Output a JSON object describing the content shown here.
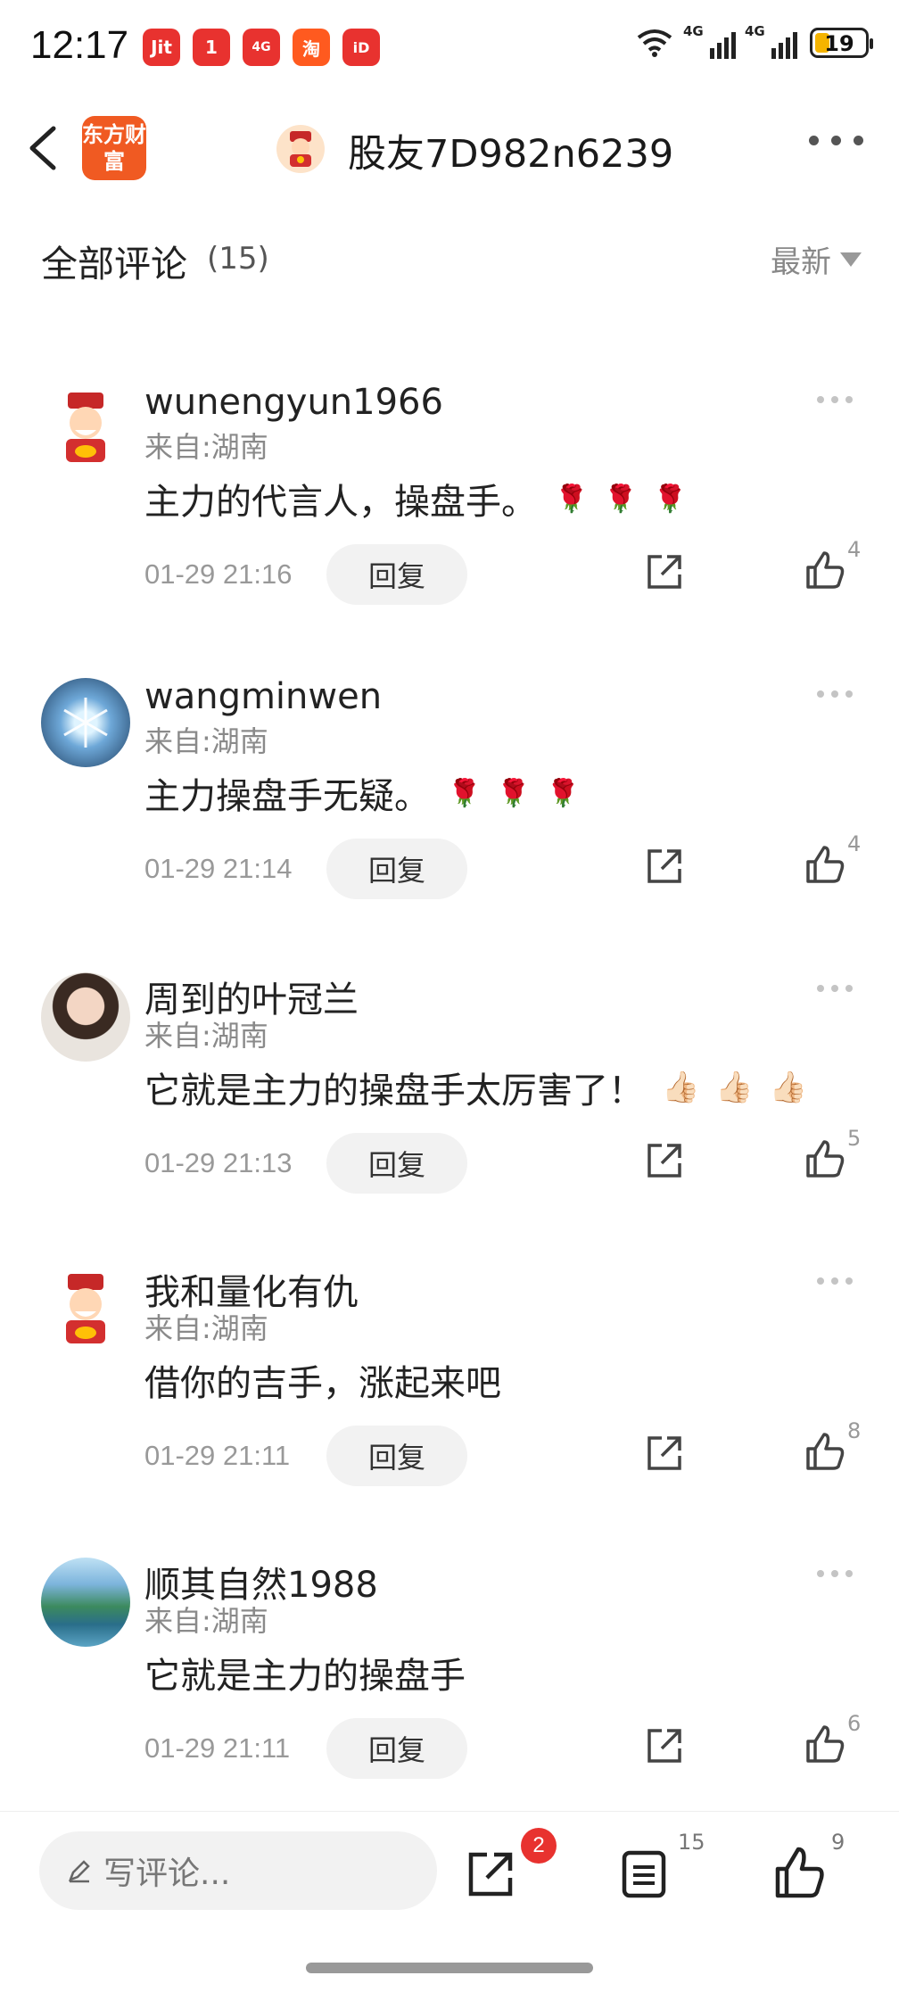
{
  "status_bar": {
    "time": "12:17",
    "app_icons": [
      "Jit",
      "1",
      "4G",
      "淘",
      "iD"
    ],
    "network_1": "4G",
    "network_2": "4G",
    "battery": "19"
  },
  "header": {
    "brand_logo": "东方财富",
    "title": "股友7D982n6239"
  },
  "section": {
    "title": "全部评论",
    "count": "(15)",
    "sort_label": "最新"
  },
  "comments": [
    {
      "username": "wunengyun1966",
      "location": "来自:湖南",
      "text": "主力的代言人，操盘手。",
      "emoji": "rose",
      "time": "01-29 21:16",
      "reply_label": "回复",
      "likes": "4"
    },
    {
      "username": "wangminwen",
      "location": "来自:湖南",
      "text": "主力操盘手无疑。",
      "emoji": "rose",
      "time": "01-29 21:14",
      "reply_label": "回复",
      "likes": "4"
    },
    {
      "username": "周到的叶冠兰",
      "location": "来自:湖南",
      "text": "它就是主力的操盘手太厉害了！",
      "emoji": "thumbs",
      "time": "01-29 21:13",
      "reply_label": "回复",
      "likes": "5"
    },
    {
      "username": "我和量化有仇",
      "location": "来自:湖南",
      "text": "借你的吉手，涨起来吧",
      "emoji": "",
      "time": "01-29 21:11",
      "reply_label": "回复",
      "likes": "8"
    },
    {
      "username": "顺其自然1988",
      "location": "来自:湖南",
      "text": "它就是主力的操盘手",
      "emoji": "",
      "time": "01-29 21:11",
      "reply_label": "回复",
      "likes": "6"
    }
  ],
  "bottom_bar": {
    "write_placeholder": "写评论...",
    "share_badge": "2",
    "comment_count": "15",
    "like_count": "9"
  },
  "colors": {
    "accent_red": "#e8322f",
    "brand_orange": "#f05a22"
  }
}
